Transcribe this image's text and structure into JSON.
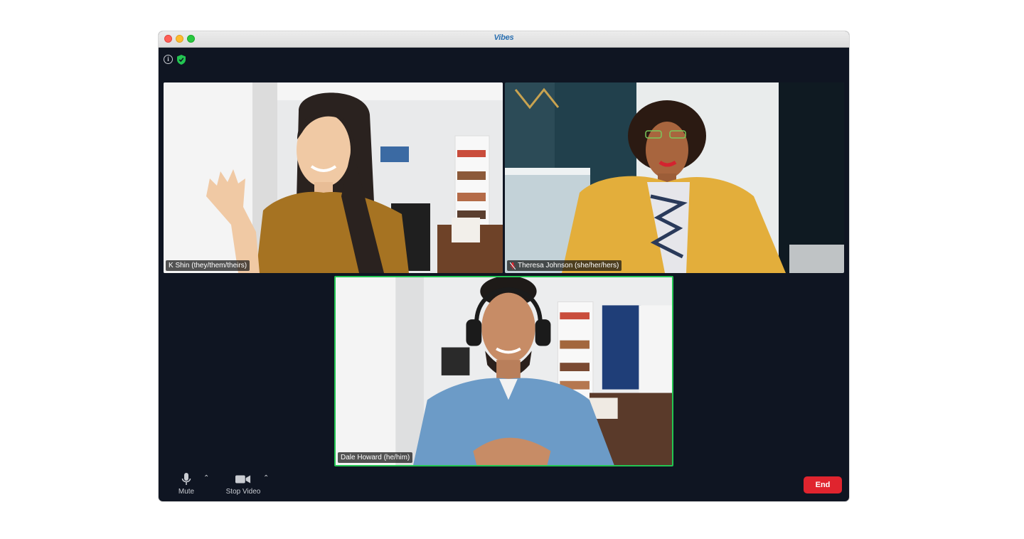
{
  "window": {
    "app_name": "Vibes"
  },
  "participants": [
    {
      "name": "K Shin (they/them/theirs)",
      "muted": false,
      "active_speaker": false
    },
    {
      "name": "Theresa Johnson (she/her/hers)",
      "muted": true,
      "active_speaker": false
    },
    {
      "name": "Dale Howard (he/him)",
      "muted": false,
      "active_speaker": true
    }
  ],
  "toolbar": {
    "mute_label": "Mute",
    "video_label": "Stop Video",
    "end_label": "End"
  },
  "colors": {
    "background": "#0f1522",
    "active_speaker_border": "#23c552",
    "end_button": "#e0242e",
    "secure_shield": "#23c552"
  },
  "icons": [
    "info-icon",
    "shield-check-icon",
    "microphone-icon",
    "video-camera-icon",
    "caret-up-icon",
    "muted-mic-icon"
  ]
}
